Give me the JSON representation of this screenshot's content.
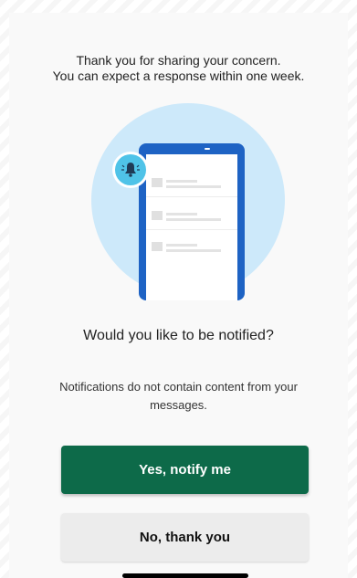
{
  "confirmation": {
    "line1": "Thank you for sharing your concern.",
    "line2": "You can expect a response within one week."
  },
  "illustration": {
    "icon": "phone-with-bell-notification",
    "colors": {
      "circle": "#cde9fa",
      "phone": "#1e63c4",
      "bell_badge": "#4fc3e8"
    }
  },
  "prompt": {
    "question": "Would you like to be notified?",
    "note": "Notifications do not contain content from your messages."
  },
  "actions": {
    "yes_label": "Yes, notify me",
    "no_label": "No, thank you"
  },
  "colors": {
    "primary": "#0d6a49",
    "secondary": "#ececec"
  }
}
